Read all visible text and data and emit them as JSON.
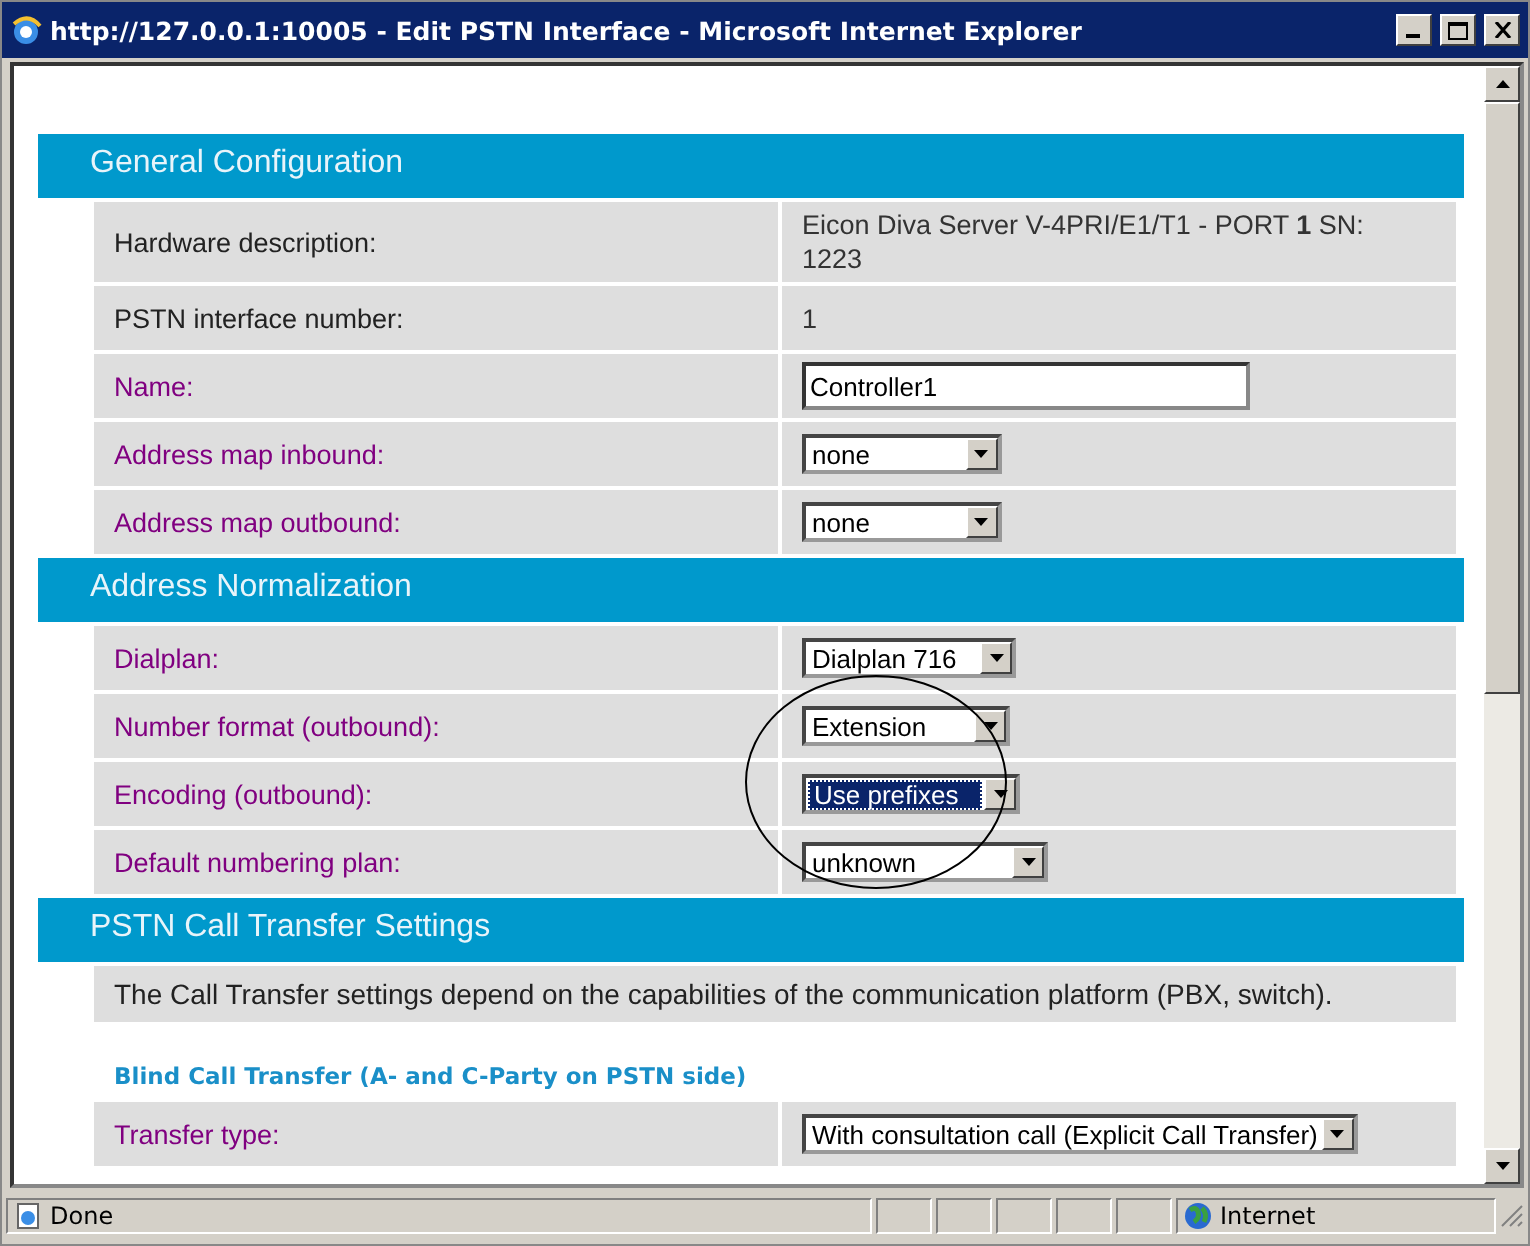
{
  "window": {
    "title": "http://127.0.0.1:10005 - Edit PSTN Interface - Microsoft Internet Explorer"
  },
  "sections": [
    {
      "title": "General Configuration",
      "rows": [
        {
          "label": "Hardware description:",
          "editable": false,
          "kind": "text",
          "value": "Eicon Diva Server V-4PRI/E1/T1 - PORT **1** SN: 1223"
        },
        {
          "label": "PSTN interface number:",
          "editable": false,
          "kind": "text",
          "value": "1"
        },
        {
          "label": "Name:",
          "editable": true,
          "kind": "input",
          "value": "Controller1"
        },
        {
          "label": "Address map inbound:",
          "editable": true,
          "kind": "select",
          "value": "none",
          "focused": false
        },
        {
          "label": "Address map outbound:",
          "editable": true,
          "kind": "select",
          "value": "none",
          "focused": false
        }
      ]
    },
    {
      "title": "Address Normalization",
      "rows": [
        {
          "label": "Dialplan:",
          "editable": true,
          "kind": "select",
          "value": "Dialplan 716",
          "focused": false
        },
        {
          "label": "Number format (outbound):",
          "editable": true,
          "kind": "select",
          "value": "Extension",
          "focused": false
        },
        {
          "label": "Encoding (outbound):",
          "editable": true,
          "kind": "select",
          "value": "Use prefixes",
          "focused": true
        },
        {
          "label": "Default numbering plan:",
          "editable": true,
          "kind": "select",
          "value": "unknown",
          "focused": false
        }
      ]
    },
    {
      "title": "PSTN Call Transfer Settings",
      "description": "The Call Transfer settings depend on the capabilities of the communication platform (PBX, switch).",
      "subtitle": "Blind Call Transfer (A- and C-Party on PSTN side)",
      "rows": [
        {
          "label": "Transfer type:",
          "editable": true,
          "kind": "select",
          "value": "With consultation call (Explicit Call Transfer)",
          "focused": false
        }
      ]
    }
  ],
  "status_bar": {
    "status": "Done",
    "zone": "Internet"
  }
}
